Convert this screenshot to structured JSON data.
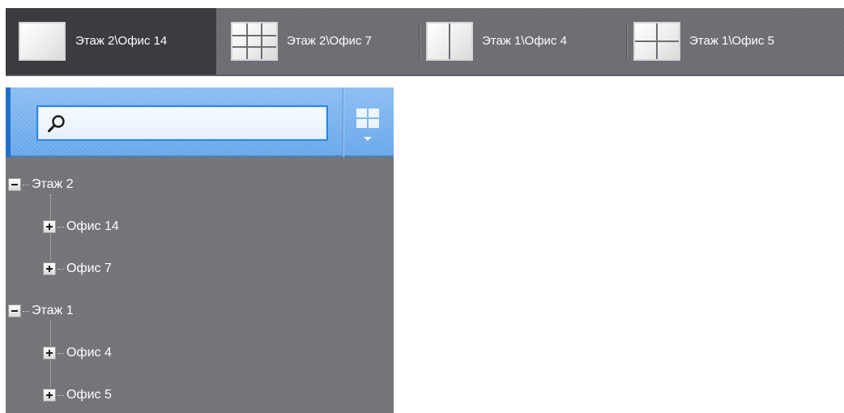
{
  "layouts": {
    "tabs": [
      {
        "label": "Этаж 2\\Офис 14",
        "grid": "1x1",
        "active": true
      },
      {
        "label": "Этаж 2\\Офис 7",
        "grid": "3x3",
        "active": false
      },
      {
        "label": "Этаж 1\\Офис 4",
        "grid": "2x1",
        "active": false
      },
      {
        "label": "Этаж 1\\Офис 5",
        "grid": "2x2",
        "active": false
      }
    ]
  },
  "search": {
    "value": "",
    "placeholder": ""
  },
  "tree": {
    "groups": [
      {
        "label": "Этаж 2",
        "expanded": true,
        "children": [
          {
            "label": "Офис 14"
          },
          {
            "label": "Офис 7"
          }
        ]
      },
      {
        "label": "Этаж 1",
        "expanded": true,
        "children": [
          {
            "label": "Офис 4"
          },
          {
            "label": "Офис 5"
          }
        ]
      }
    ]
  },
  "colors": {
    "panel_bg": "#747479",
    "header_bg": "#6e6e74",
    "active_tab_bg": "#3b3b40",
    "search_bar_bg": "#7fb7f2",
    "search_border": "#2d86e0",
    "accent": "#1f70c9"
  },
  "icons": {
    "search": "search-icon",
    "layout_menu": "layout-grid-icon",
    "expanded_node": "minus-icon",
    "collapsed_node": "plus-icon"
  }
}
